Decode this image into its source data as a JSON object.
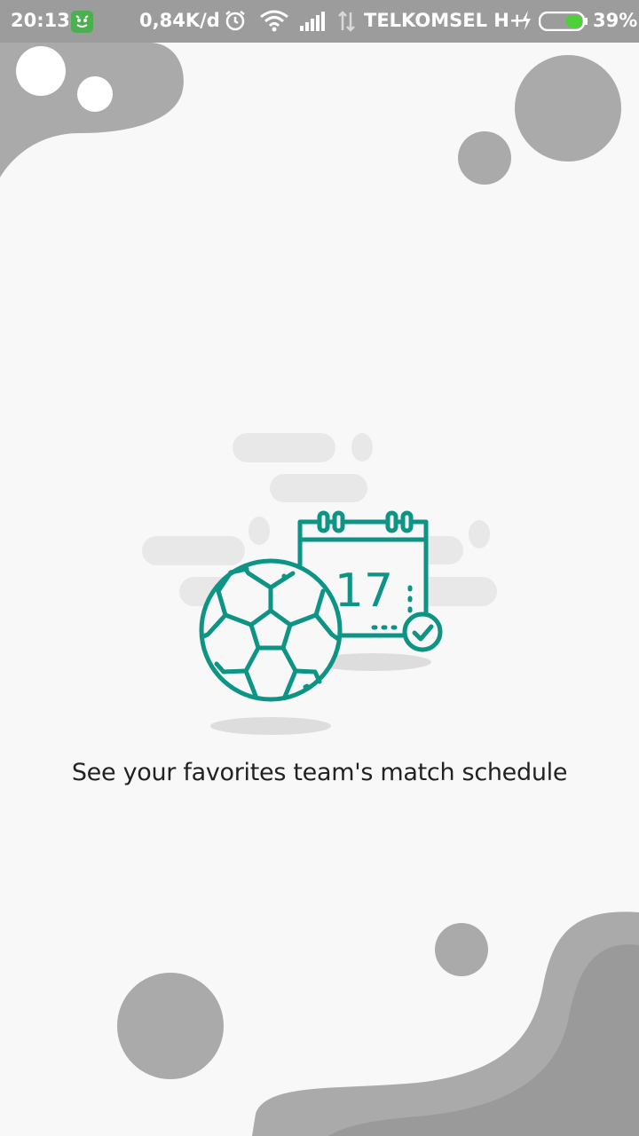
{
  "status_bar": {
    "time": "20:13",
    "net_speed": "0,84K/d",
    "carrier": "TELKOMSEL H+",
    "battery_percent": "39%",
    "battery_level": 0.39,
    "icons": [
      "app-icon",
      "alarm-icon",
      "wifi-icon",
      "signal-icon",
      "data-arrows-icon",
      "charging-icon",
      "battery-icon"
    ]
  },
  "illustration": {
    "calendar_day": "17",
    "icons": [
      "soccer-ball-icon",
      "calendar-icon",
      "check-icon"
    ]
  },
  "caption": "See your favorites team's match schedule",
  "colors": {
    "accent": "#0e9484",
    "status_bar": "#9c9c9c",
    "background": "#f8f8f8",
    "blob": "#aaaaaa",
    "blob_dark": "#9a9a9a",
    "cloud": "#e8e8e8"
  }
}
